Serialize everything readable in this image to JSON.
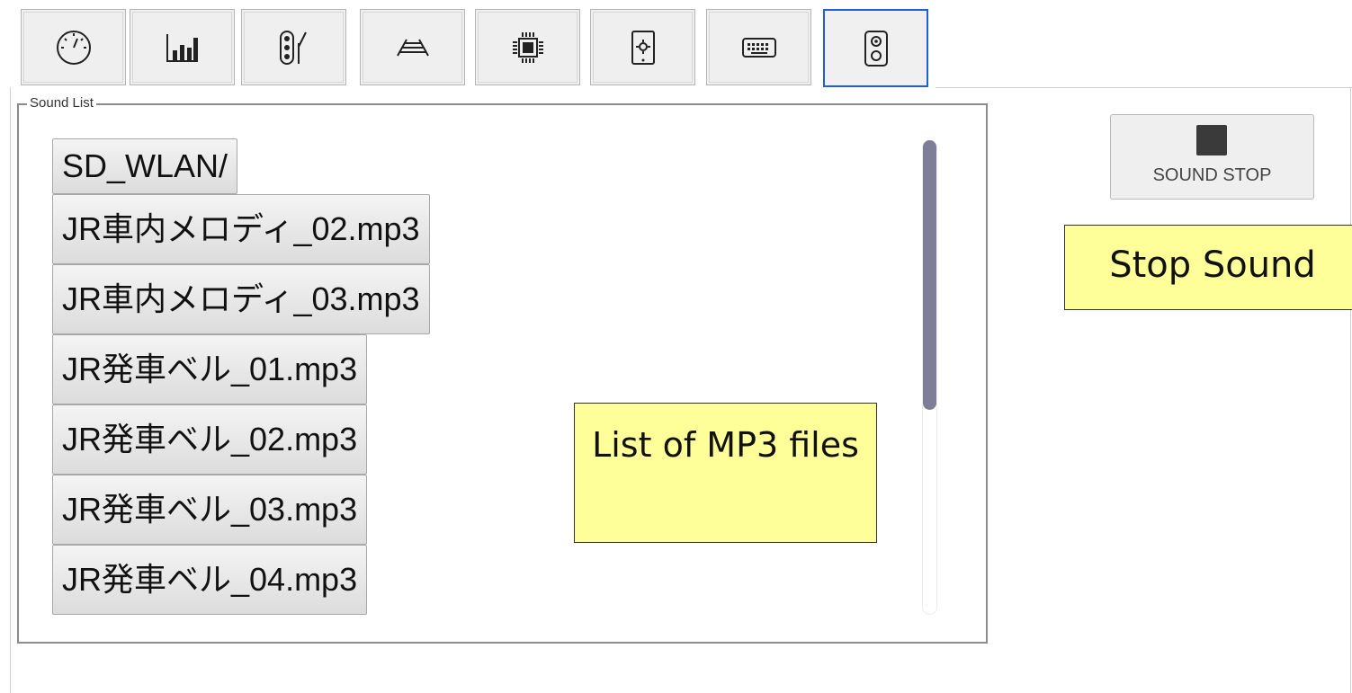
{
  "tabs": [
    {
      "icon": "speedometer-icon"
    },
    {
      "icon": "bar-chart-icon"
    },
    {
      "icon": "signal-switch-icon"
    },
    {
      "icon": "track-icon"
    },
    {
      "icon": "chip-icon"
    },
    {
      "icon": "tablet-settings-icon"
    },
    {
      "icon": "keyboard-icon"
    },
    {
      "icon": "speaker-icon",
      "active": true
    }
  ],
  "sound_list": {
    "legend": "Sound List",
    "items": [
      "SD_WLAN/",
      "JR車内メロディ_02.mp3",
      "JR車内メロディ_03.mp3",
      "JR発車ベル_01.mp3",
      "JR発車ベル_02.mp3",
      "JR発車ベル_03.mp3",
      "JR発車ベル_04.mp3"
    ]
  },
  "sound_stop": {
    "label": "SOUND STOP"
  },
  "callouts": {
    "stop": "Stop Sound",
    "list": "List of MP3 files"
  },
  "colors": {
    "active_tab_border": "#1e5fe0",
    "callout_bg": "#ffff99",
    "scroll_thumb": "#7e7e98"
  }
}
